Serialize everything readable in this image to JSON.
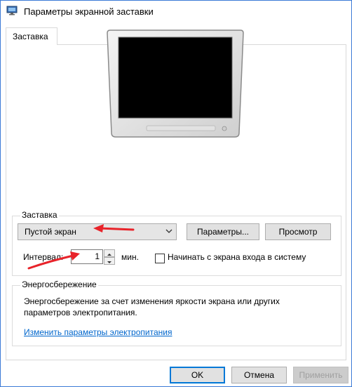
{
  "window": {
    "title": "Параметры экранной заставки"
  },
  "tabs": [
    {
      "label": "Заставка"
    }
  ],
  "screensaver": {
    "group_label": "Заставка",
    "selected": "Пустой экран",
    "settings_label": "Параметры...",
    "preview_label": "Просмотр",
    "interval_label": "Интервал:",
    "interval_value": "1",
    "interval_unit": "мин.",
    "resume_label": "Начинать с экрана входа в систему",
    "resume_checked": false
  },
  "power": {
    "group_label": "Энергосбережение",
    "description_line1": "Энергосбережение за счет изменения яркости экрана или других",
    "description_line2": "параметров электропитания.",
    "link_label": "Изменить параметры электропитания"
  },
  "footer": {
    "ok_label": "OK",
    "cancel_label": "Отмена",
    "apply_label": "Применить"
  },
  "colors": {
    "accent": "#0078d7",
    "annotation_arrow": "#e8232a",
    "link": "#0066cc"
  }
}
